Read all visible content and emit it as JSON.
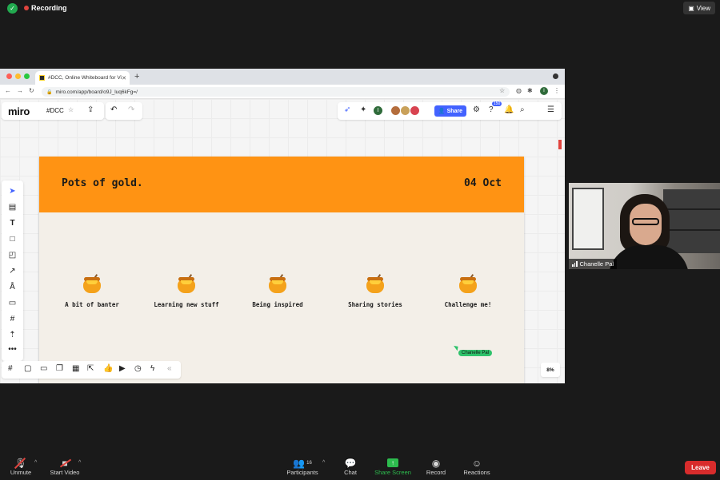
{
  "zoom_top": {
    "recording_label": "Recording",
    "view_label": "View"
  },
  "browser": {
    "tab_title": "#DCC, Online Whiteboard for Vi",
    "url": "miro.com/app/board/o9J_luq6kFg=/",
    "profile_initial": "I"
  },
  "miro": {
    "logo": "miro",
    "board_name": "#DCC",
    "share_label": "Share",
    "help_badge": "150",
    "user_initial": "I",
    "zoom_level": "8%"
  },
  "frame": {
    "title": "Pots of gold.",
    "date": "04 Oct",
    "header_color": "#ff9313",
    "items": [
      {
        "label": "A bit of banter"
      },
      {
        "label": "Learning new stuff"
      },
      {
        "label": "Being inspired"
      },
      {
        "label": "Sharing stories"
      },
      {
        "label": "Challenge me!"
      }
    ],
    "cursor_name": "Chanelle Pal"
  },
  "participant": {
    "name": "Chanelle Pal"
  },
  "controls": {
    "unmute": "Unmute",
    "start_video": "Start Video",
    "participants": "Participants",
    "participants_count": "16",
    "chat": "Chat",
    "share_screen": "Share Screen",
    "record": "Record",
    "reactions": "Reactions",
    "leave": "Leave"
  },
  "icons": {
    "security": "shield-check-icon",
    "recording": "red-dot-icon",
    "honey_pot": "honey-pot-icon"
  }
}
